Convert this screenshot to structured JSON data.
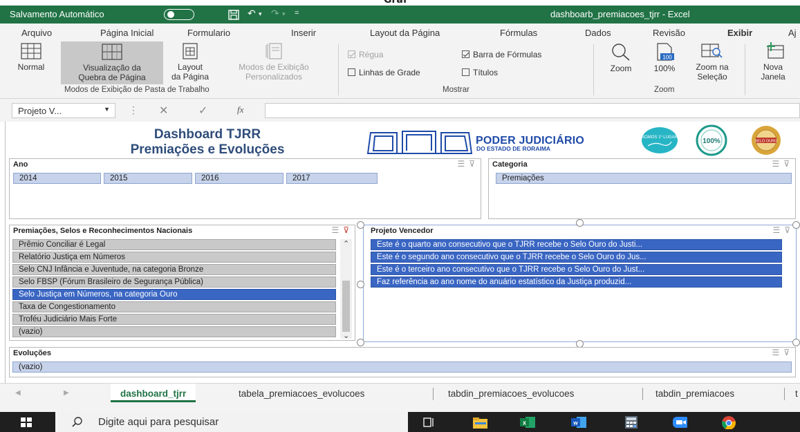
{
  "window": {
    "autosave_label": "Salvamento Automático",
    "autosave_state": "Desativado",
    "doc_title": "dashboarb_premiacoes_tjrr  -  Excel"
  },
  "menu": [
    "Arquivo",
    "Página Inicial",
    "Formulario",
    "Inserir",
    "Layout da Página",
    "Fórmulas",
    "Dados",
    "Revisão",
    "Exibir",
    "Aj"
  ],
  "ribbon": {
    "normal": "Normal",
    "page_break_1": "Visualização da",
    "page_break_2": "Quebra de Página",
    "layout_1": "Layout",
    "layout_2": "da Página",
    "custom_1": "Modos de Exibição",
    "custom_2": "Personalizados",
    "group_views": "Modos de Exibição de Pasta de Trabalho",
    "ruler": "Régua",
    "formula_bar": "Barra de Fórmulas",
    "gridlines": "Linhas de Grade",
    "headings": "Títulos",
    "group_show": "Mostrar",
    "zoom": "Zoom",
    "zoom100": "100%",
    "zoom_sel_1": "Zoom na",
    "zoom_sel_2": "Seleção",
    "group_zoom": "Zoom",
    "new_window_1": "Nova",
    "new_window_2": "Janela",
    "zoom100_icon_text": "100",
    "ruler_checked": true,
    "formula_bar_checked": true,
    "gridlines_checked": false,
    "headings_checked": false
  },
  "formula_bar": {
    "name_box": "Projeto V...",
    "fx": "fx",
    "content": ""
  },
  "dashboard": {
    "title_1": "Dashboard TJRR",
    "title_2": "Premiações e Evoluções",
    "org_line_1": "PODER JUDICIÁRIO",
    "org_line_2": "DO ESTADO DE RORAIMA",
    "badge_1": "SOMOS 1º LUGAR",
    "badge_2": "100%",
    "badge_3": "SELO OURO"
  },
  "slicers": {
    "ano": {
      "title": "Ano",
      "items": [
        "2014",
        "2015",
        "2016",
        "2017"
      ]
    },
    "categoria": {
      "title": "Categoria",
      "items": [
        "Premiações"
      ]
    },
    "premiacoes": {
      "title": "Premiações, Selos e Reconhecimentos Nacionais",
      "items": [
        "Prêmio Conciliar é Legal",
        "Relatório Justiça em Números",
        "Selo CNJ Infância e Juventude, na categoria Bronze",
        "Selo FBSP (Fórum Brasileiro de Segurança Pública)",
        "Selo Justiça em Números, na categoria Ouro",
        "Taxa de Congestionamento",
        "Troféu Judiciário Mais Forte",
        "(vazio)"
      ],
      "selected_index": 4
    },
    "projeto": {
      "title": "Projeto Vencedor",
      "items": [
        "Este é o quarto ano consecutivo que o TJRR recebe o Selo Ouro do Justi...",
        "Este é o segundo ano consecutivo que o TJRR recebe o Selo Ouro do Jus...",
        "Este é o terceiro ano consecutivo que o TJRR recebe o Selo Ouro do Just...",
        "Faz referência ao ano nome do anuário estatístico da Justiça produzid..."
      ]
    },
    "evolucoes": {
      "title": "Evoluções",
      "items": [
        "(vazio)"
      ]
    }
  },
  "sheet_tabs": [
    "dashboard_tjrr",
    "tabela_premiacoes_evolucoes",
    "tabdin_premiacoes_evolucoes",
    "tabdin_premiacoes",
    "t"
  ],
  "taskbar": {
    "search_placeholder": "Digite aqui para pesquisar",
    "apps": [
      "task-view",
      "file-explorer",
      "excel",
      "word",
      "calculator",
      "zoom",
      "chrome"
    ]
  },
  "colors": {
    "excel_green": "#217346",
    "selected_item": "#3a66c3",
    "title_blue": "#2f4d7a"
  }
}
